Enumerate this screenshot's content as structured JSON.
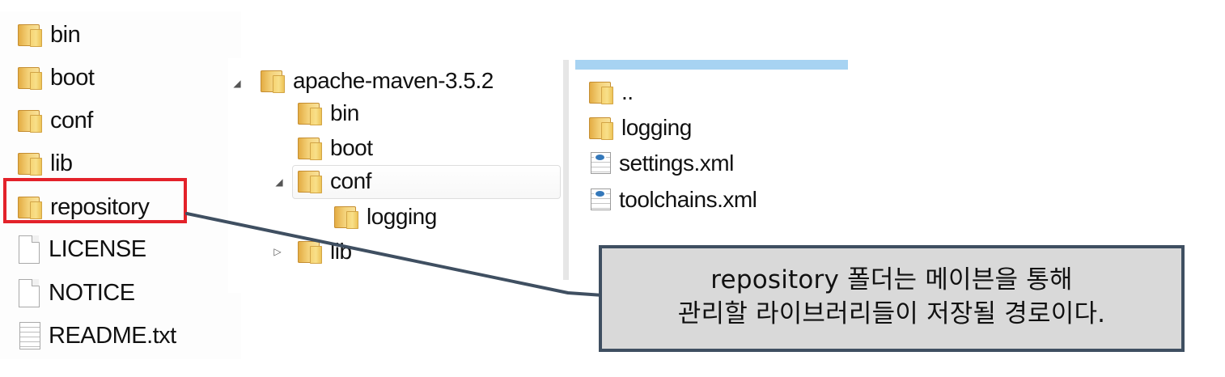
{
  "left_panel": {
    "items": [
      {
        "label": "bin",
        "icon": "folder-icon"
      },
      {
        "label": "boot",
        "icon": "folder-icon"
      },
      {
        "label": "conf",
        "icon": "folder-icon"
      },
      {
        "label": "lib",
        "icon": "folder-icon"
      },
      {
        "label": "repository",
        "icon": "folder-icon"
      },
      {
        "label": "LICENSE",
        "icon": "document-icon"
      },
      {
        "label": "NOTICE",
        "icon": "document-icon"
      },
      {
        "label": "README.txt",
        "icon": "text-document-icon"
      }
    ]
  },
  "tree_panel": {
    "root": "apache-maven-3.5.2",
    "items": [
      {
        "label": "bin"
      },
      {
        "label": "boot"
      },
      {
        "label": "conf"
      },
      {
        "label": "logging"
      },
      {
        "label": "lib"
      }
    ]
  },
  "right_panel": {
    "items": [
      {
        "label": "..",
        "icon": "folder-icon"
      },
      {
        "label": "logging",
        "icon": "folder-icon"
      },
      {
        "label": "settings.xml",
        "icon": "xml-file-icon"
      },
      {
        "label": "toolchains.xml",
        "icon": "xml-file-icon"
      }
    ]
  },
  "callout": {
    "line1": "repository 폴더는 메이븐을 통해",
    "line2": "관리할 라이브러리들이 저장될 경로이다."
  },
  "colors": {
    "highlight": "#e3222a",
    "callout_border": "#3f4f61",
    "callout_background": "#d9d9d9",
    "header_blue": "#a7d3f2"
  }
}
